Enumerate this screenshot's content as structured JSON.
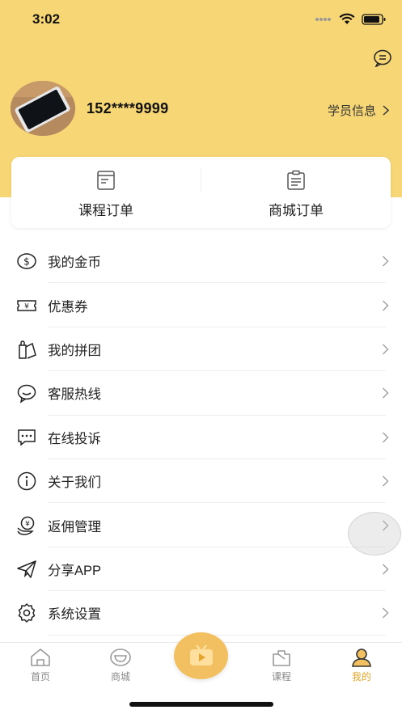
{
  "status_bar": {
    "time": "3:02"
  },
  "profile": {
    "phone": "152****9999",
    "info_link": "学员信息"
  },
  "orders": [
    {
      "label": "课程订单",
      "icon": "course-order-icon"
    },
    {
      "label": "商城订单",
      "icon": "mall-order-icon"
    }
  ],
  "menu": [
    {
      "label": "我的金币",
      "icon": "coin-icon"
    },
    {
      "label": "优惠券",
      "icon": "coupon-icon"
    },
    {
      "label": "我的拼团",
      "icon": "group-buy-icon"
    },
    {
      "label": "客服热线",
      "icon": "chat-bubble-icon"
    },
    {
      "label": "在线投诉",
      "icon": "complaint-icon"
    },
    {
      "label": "关于我们",
      "icon": "info-icon"
    },
    {
      "label": "返佣管理",
      "icon": "commission-icon"
    },
    {
      "label": "分享APP",
      "icon": "share-icon"
    },
    {
      "label": "系统设置",
      "icon": "settings-icon"
    }
  ],
  "tabbar": {
    "tabs": [
      {
        "label": "首页",
        "icon": "home-icon",
        "active": false
      },
      {
        "label": "商城",
        "icon": "mall-icon",
        "active": false
      },
      {
        "label": "课程",
        "icon": "course-icon",
        "active": false
      },
      {
        "label": "我的",
        "icon": "profile-icon",
        "active": true
      }
    ],
    "center": {
      "icon": "tv-play-icon"
    }
  },
  "colors": {
    "accent": "#f7d675",
    "active_tab": "#e5a42b",
    "center_button": "#f3c061"
  }
}
